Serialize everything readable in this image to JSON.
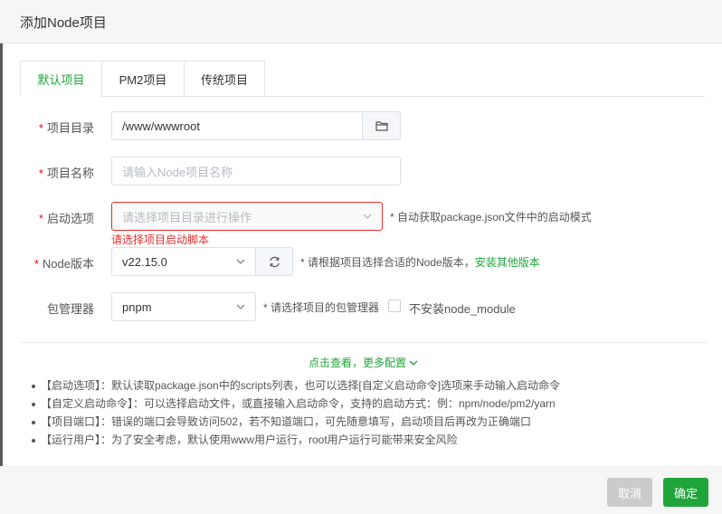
{
  "dialog": {
    "title": "添加Node项目",
    "cancel_label": "取消",
    "confirm_label": "确定"
  },
  "tabs": [
    {
      "label": "默认项目",
      "active": true
    },
    {
      "label": "PM2项目",
      "active": false
    },
    {
      "label": "传统项目",
      "active": false
    }
  ],
  "form": {
    "required_mark": "*",
    "project_dir": {
      "label": "项目目录",
      "value": "/www/wwwroot"
    },
    "project_name": {
      "label": "项目名称",
      "placeholder": "请输入Node项目名称"
    },
    "start_option": {
      "label": "启动选项",
      "placeholder": "请选择项目目录进行操作",
      "hint": "* 自动获取package.json文件中的启动模式",
      "error": "请选择项目启动脚本"
    },
    "node_version": {
      "label": "Node版本",
      "value": "v22.15.0",
      "hint": "* 请根据项目选择合适的Node版本，",
      "link": "安装其他版本"
    },
    "package_manager": {
      "label": "包管理器",
      "value": "pnpm",
      "hint": "* 请选择项目的包管理器",
      "checkbox_label": "不安装node_module"
    }
  },
  "more": {
    "label": "点击查看，更多配置"
  },
  "notes": [
    "【启动选项】：默认读取package.json中的scripts列表，也可以选择[自定义启动命令]选项来手动输入启动命令",
    "【自定义启动命令】：可以选择启动文件，或直接输入启动命令，支持的启动方式：例：npm/node/pm2/yarn",
    "【项目端口】：错误的端口会导致访问502，若不知道端口，可先随意填写，启动项目后再改为正确端口",
    "【运行用户】：为了安全考虑，默认使用www用户运行，root用户运行可能带来安全风险"
  ],
  "colors": {
    "accent": "#20a53a",
    "error": "#e12f2f"
  }
}
